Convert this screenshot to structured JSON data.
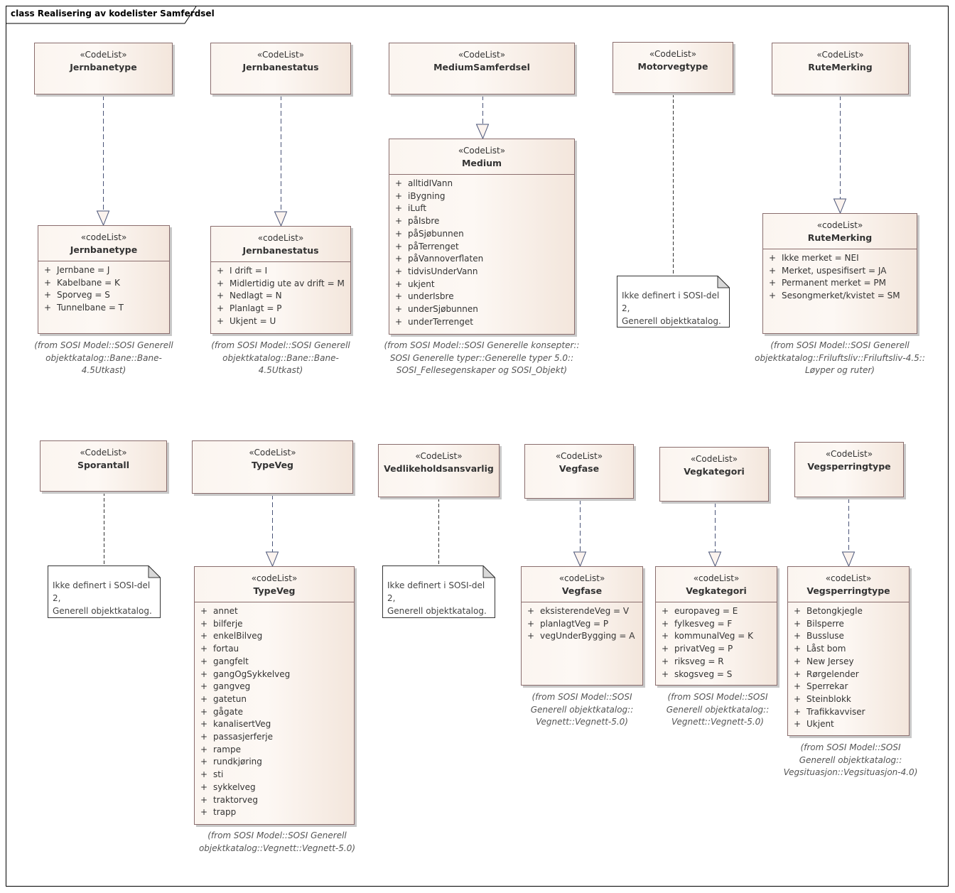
{
  "frame": {
    "title": "class Realisering av kodelister Samferdsel"
  },
  "colors": {
    "class_border": "#8a6d6d",
    "class_fill_light": "#fbf5f0",
    "class_fill_dark": "#f3e6dc",
    "connector": "#4a5478",
    "note_fold": "#d8d8d8"
  },
  "upper_classes": [
    {
      "id": "jernbanetype-cl",
      "stereotype": "«CodeList»",
      "name": "Jernbanetype"
    },
    {
      "id": "jernbanestatus-cl",
      "stereotype": "«CodeList»",
      "name": "Jernbanestatus"
    },
    {
      "id": "mediumsamferdsel-cl",
      "stereotype": "«CodeList»",
      "name": "MediumSamferdsel"
    },
    {
      "id": "motorvegtype-cl",
      "stereotype": "«CodeList»",
      "name": "Motorvegtype"
    },
    {
      "id": "rutemerking-cl",
      "stereotype": "«CodeList»",
      "name": "RuteMerking"
    },
    {
      "id": "sporantall-cl",
      "stereotype": "«CodeList»",
      "name": "Sporantall"
    },
    {
      "id": "typeveg-cl",
      "stereotype": "«CodeList»",
      "name": "TypeVeg"
    },
    {
      "id": "vedlikeholdsansvarlig-cl",
      "stereotype": "«CodeList»",
      "name": "Vedlikeholdsansvarlig"
    },
    {
      "id": "vegfase-cl",
      "stereotype": "«CodeList»",
      "name": "Vegfase"
    },
    {
      "id": "vegkategori-cl",
      "stereotype": "«CodeList»",
      "name": "Vegkategori"
    },
    {
      "id": "vegsperringtype-cl",
      "stereotype": "«CodeList»",
      "name": "Vegsperringtype"
    }
  ],
  "lower_classes": [
    {
      "id": "jernbanetype",
      "stereotype": "«codeList»",
      "name": "Jernbanetype",
      "attributes": [
        {
          "vis": "+",
          "name": "Jernbane = J"
        },
        {
          "vis": "+",
          "name": "Kabelbane = K"
        },
        {
          "vis": "+",
          "name": "Sporveg = S"
        },
        {
          "vis": "+",
          "name": "Tunnelbane = T"
        }
      ],
      "from": "(from SOSI Model::SOSI Generell\nobjektkatalog::Bane::Bane-\n4.5Utkast)"
    },
    {
      "id": "jernbanestatus",
      "stereotype": "«codeList»",
      "name": "Jernbanestatus",
      "attributes": [
        {
          "vis": "+",
          "name": "I drift = I"
        },
        {
          "vis": "+",
          "name": "Midlertidig ute av drift = M"
        },
        {
          "vis": "+",
          "name": "Nedlagt = N"
        },
        {
          "vis": "+",
          "name": "Planlagt = P"
        },
        {
          "vis": "+",
          "name": "Ukjent = U"
        }
      ],
      "from": "(from SOSI Model::SOSI Generell\nobjektkatalog::Bane::Bane-\n4.5Utkast)"
    },
    {
      "id": "medium",
      "stereotype": "«CodeList»",
      "name": "Medium",
      "attributes": [
        {
          "vis": "+",
          "name": "alltidIVann"
        },
        {
          "vis": "+",
          "name": "iBygning"
        },
        {
          "vis": "+",
          "name": "iLuft"
        },
        {
          "vis": "+",
          "name": "påIsbre"
        },
        {
          "vis": "+",
          "name": "påSjøbunnen"
        },
        {
          "vis": "+",
          "name": "påTerrenget"
        },
        {
          "vis": "+",
          "name": "påVannoverflaten"
        },
        {
          "vis": "+",
          "name": "tidvisUnderVann"
        },
        {
          "vis": "+",
          "name": "ukjent"
        },
        {
          "vis": "+",
          "name": "underIsbre"
        },
        {
          "vis": "+",
          "name": "underSjøbunnen"
        },
        {
          "vis": "+",
          "name": "underTerrenget"
        }
      ],
      "from": "(from SOSI Model::SOSI Generelle konsepter::\nSOSI Generelle typer::Generelle typer 5.0::\nSOSI_Fellesegenskaper og SOSI_Objekt)"
    },
    {
      "id": "rutemerking",
      "stereotype": "«codeList»",
      "name": "RuteMerking",
      "attributes": [
        {
          "vis": "+",
          "name": "Ikke merket = NEI"
        },
        {
          "vis": "+",
          "name": "Merket, uspesifisert = JA"
        },
        {
          "vis": "+",
          "name": "Permanent merket = PM"
        },
        {
          "vis": "+",
          "name": "Sesongmerket/kvistet = SM"
        }
      ],
      "from": "(from SOSI Model::SOSI Generell\nobjektkatalog::Friluftsliv::Friluftsliv-4.5::\nLøyper og ruter)"
    },
    {
      "id": "typeveg",
      "stereotype": "«codeList»",
      "name": "TypeVeg",
      "attributes": [
        {
          "vis": "+",
          "name": "annet"
        },
        {
          "vis": "+",
          "name": "bilferje"
        },
        {
          "vis": "+",
          "name": "enkelBilveg"
        },
        {
          "vis": "+",
          "name": "fortau"
        },
        {
          "vis": "+",
          "name": "gangfelt"
        },
        {
          "vis": "+",
          "name": "gangOgSykkelveg"
        },
        {
          "vis": "+",
          "name": "gangveg"
        },
        {
          "vis": "+",
          "name": "gatetun"
        },
        {
          "vis": "+",
          "name": "gågate"
        },
        {
          "vis": "+",
          "name": "kanalisertVeg"
        },
        {
          "vis": "+",
          "name": "passasjerferje"
        },
        {
          "vis": "+",
          "name": "rampe"
        },
        {
          "vis": "+",
          "name": "rundkjøring"
        },
        {
          "vis": "+",
          "name": "sti"
        },
        {
          "vis": "+",
          "name": "sykkelveg"
        },
        {
          "vis": "+",
          "name": "traktorveg"
        },
        {
          "vis": "+",
          "name": "trapp"
        }
      ],
      "from": "(from SOSI Model::SOSI Generell\nobjektkatalog::Vegnett::Vegnett-5.0)"
    },
    {
      "id": "vegfase",
      "stereotype": "«codeList»",
      "name": "Vegfase",
      "attributes": [
        {
          "vis": "+",
          "name": "eksisterendeVeg = V"
        },
        {
          "vis": "+",
          "name": "planlagtVeg = P"
        },
        {
          "vis": "+",
          "name": "vegUnderBygging = A"
        }
      ],
      "from": "(from SOSI Model::SOSI\nGenerell objektkatalog::\nVegnett::Vegnett-5.0)"
    },
    {
      "id": "vegkategori",
      "stereotype": "«codeList»",
      "name": "Vegkategori",
      "attributes": [
        {
          "vis": "+",
          "name": "europaveg = E"
        },
        {
          "vis": "+",
          "name": "fylkesveg = F"
        },
        {
          "vis": "+",
          "name": "kommunalVeg = K"
        },
        {
          "vis": "+",
          "name": "privatVeg = P"
        },
        {
          "vis": "+",
          "name": "riksveg = R"
        },
        {
          "vis": "+",
          "name": "skogsveg = S"
        }
      ],
      "from": "(from SOSI Model::SOSI\nGenerell objektkatalog::\nVegnett::Vegnett-5.0)"
    },
    {
      "id": "vegsperringtype",
      "stereotype": "«codeList»",
      "name": "Vegsperringtype",
      "attributes": [
        {
          "vis": "+",
          "name": "Betongkjegle"
        },
        {
          "vis": "+",
          "name": "Bilsperre"
        },
        {
          "vis": "+",
          "name": "Bussluse"
        },
        {
          "vis": "+",
          "name": "Låst bom"
        },
        {
          "vis": "+",
          "name": "New Jersey"
        },
        {
          "vis": "+",
          "name": "Rørgelender"
        },
        {
          "vis": "+",
          "name": "Sperrekar"
        },
        {
          "vis": "+",
          "name": "Steinblokk"
        },
        {
          "vis": "+",
          "name": "Trafikkavviser"
        },
        {
          "vis": "+",
          "name": "Ukjent"
        }
      ],
      "from": "(from SOSI Model::SOSI\nGenerell objektkatalog::\nVegsituasjon::Vegsituasjon-4.0)"
    }
  ],
  "notes": [
    {
      "id": "motorvegtype-note",
      "text": "Ikke definert i SOSI-del 2,\nGenerell objektkatalog."
    },
    {
      "id": "sporantall-note",
      "text": "Ikke definert i SOSI-del 2,\nGenerell objektkatalog."
    },
    {
      "id": "vedlikeholdsansvarlig-note",
      "text": "Ikke definert i SOSI-del 2,\nGenerell objektkatalog."
    }
  ]
}
